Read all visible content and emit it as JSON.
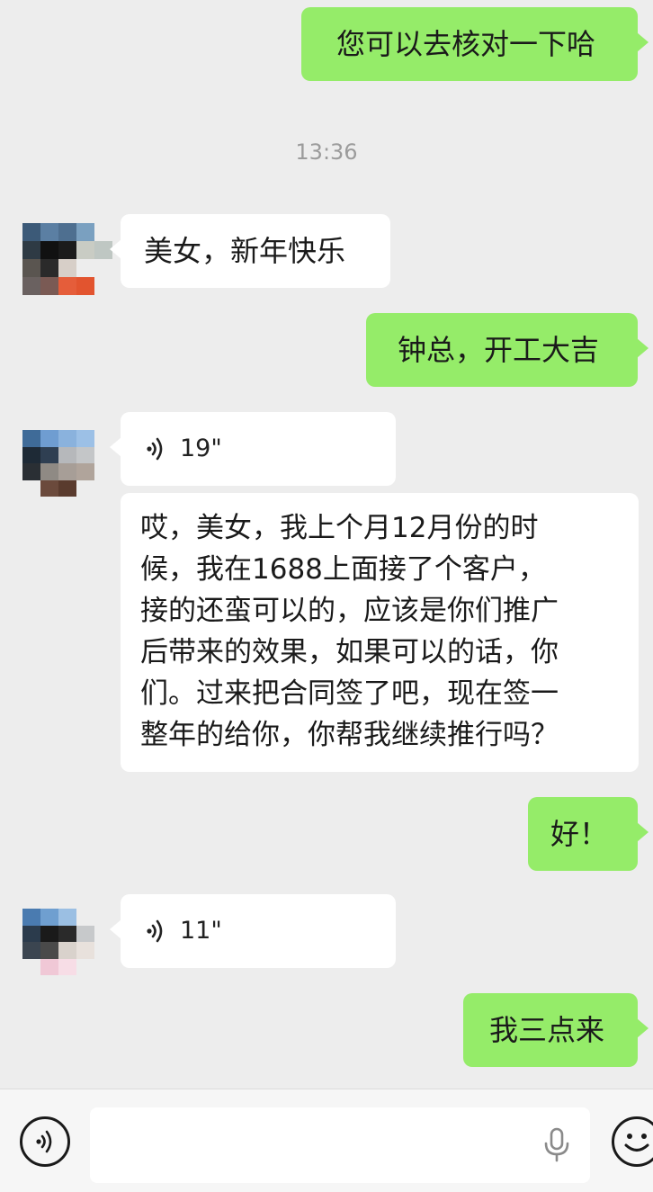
{
  "messages": {
    "m1": "您可以去核对一下哈",
    "time": "13:36",
    "m2": "美女，新年快乐",
    "m3": "钟总，开工大吉",
    "voice1": "19\"",
    "long_lines": [
      "哎，美女，我上个月12月份的时",
      "候，我在1688上面接了个客户，",
      "接的还蛮可以的，应该是你们推广",
      "后带来的效果，如果可以的话，你",
      "们。过来把合同签了吧，现在签一",
      "整年的给你，你帮我继续推行吗？"
    ],
    "m4": "好！",
    "voice2": "11\"",
    "m5": "我三点来"
  },
  "colors": {
    "sent_bubble": "#95ec69",
    "recv_bubble": "#ffffff",
    "background": "#ededed"
  },
  "icons": {
    "voice_playback": "voice-wave-icon",
    "voice_input": "voice-input-icon",
    "mic": "mic-icon",
    "emoji": "emoji-icon"
  }
}
